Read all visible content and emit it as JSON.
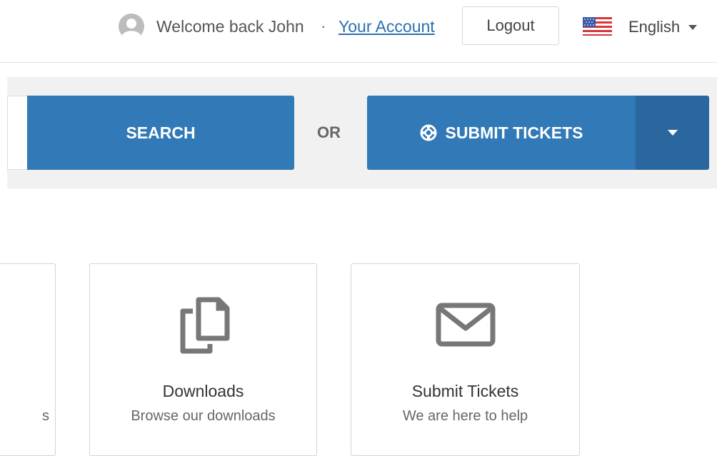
{
  "header": {
    "welcome_text": "Welcome back John",
    "separator": "·",
    "account_link": "Your Account",
    "logout_label": "Logout",
    "language": "English",
    "avatar_icon": "user-avatar-icon",
    "flag_icon": "us-flag-icon"
  },
  "search": {
    "button_label": "SEARCH",
    "or_label": "OR",
    "submit_label": "SUBMIT TICKETS",
    "submit_icon": "lifebuoy-icon",
    "dropdown_icon": "caret-down-icon"
  },
  "cards": [
    {
      "desc": "s"
    },
    {
      "title": "Downloads",
      "desc": "Browse our downloads",
      "icon": "documents-icon"
    },
    {
      "title": "Submit Tickets",
      "desc": "We are here to help",
      "icon": "envelope-icon"
    }
  ],
  "colors": {
    "primary": "#3279b7",
    "primary_dark": "#2a679e",
    "link": "#2d6fb0",
    "band_bg": "#f1f1f1"
  }
}
